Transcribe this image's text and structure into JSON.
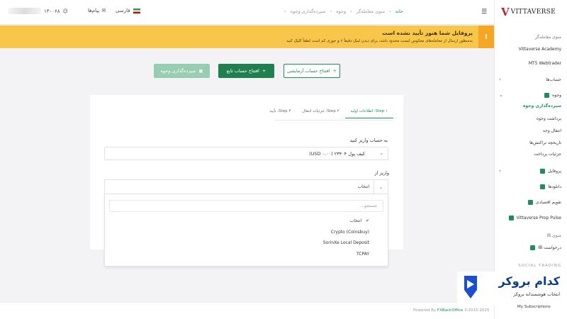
{
  "header": {
    "user_id": "۱۳۰۰۶۸",
    "messages_label": "پیام‌ها",
    "language_label": "فارسی",
    "breadcrumb": [
      "خانه",
      "منوی معامله‌گر",
      "وجوه",
      "سپرده‌گذاری وجوه"
    ]
  },
  "warning": {
    "title": "پروفایل شما هنوز تأیید نشده است",
    "subtitle": "به‌منظور ارسال از معامله‌های معکوس ایست محدود باشد، برای دیدن لینک دقیقاً ۶ و جوزی کم است لطفاً کلیک کنید"
  },
  "actions": {
    "demo_label": "افتتاح حساب آزمایشی",
    "open_label": "افتتاح حساب تابع",
    "deposit_label": "سپرده‌گذاری وجوه"
  },
  "steps": [
    {
      "label": "Step ۱: اطلاعات اولیه",
      "active": true
    },
    {
      "label": "Step ۲: جزئیات انتقال",
      "active": false
    },
    {
      "label": "Step ۳: تأیید",
      "active": false
    }
  ],
  "form": {
    "account_label": "به حساب واریز کنید",
    "account_value": "کیف پول ۲۳۴۰۴ (USD ۰.۰۰)",
    "from_label": "واریز از",
    "from_value": "انتخاب",
    "search_placeholder": "جستجو...",
    "options": [
      "انتخاب",
      "Crypto (Coinsbuy)",
      "SorinXe Local Deposit",
      "TCPAY"
    ],
    "selected_index": 0
  },
  "footer": {
    "powered_by": "Powered By",
    "brand": "FXBackOffice",
    "years": "©2015-2025"
  },
  "sidebar": {
    "logo_mark": "V",
    "logo_text": "VITTAVERSE",
    "trader_menu": "منوی معامله‌گر",
    "academy": "Vittaverse Academy",
    "mt5": "MT5 Webtrader",
    "accounts": "حساب‌ها",
    "funds": "وجوه",
    "funds_sub": [
      "سپرده‌گذاری وجوه",
      "برداشت وجوه",
      "انتقال وجه",
      "تاریخچه تراکنش‌ها",
      "جزئیات پرداخت"
    ],
    "profile": "پروفایل",
    "downloads": "دانلودها",
    "calendar": "تقویم اقتصادی",
    "prop": "Vittaverse Prop Pulse",
    "ib_menu": "منوی IB",
    "ib_request": "درخواست IB",
    "social": "SOCIAL TRADING",
    "subscriptions": "My Subscriptions"
  },
  "watermark": {
    "title": "کدام بروکر",
    "subtitle": "انتخاب هوشمندانه بروکر"
  },
  "colors": {
    "brand_green": "#1f8e5a",
    "warning_bg": "#f8c64a",
    "warning_icon": "#f5a623",
    "logo_red": "#c0272d"
  }
}
